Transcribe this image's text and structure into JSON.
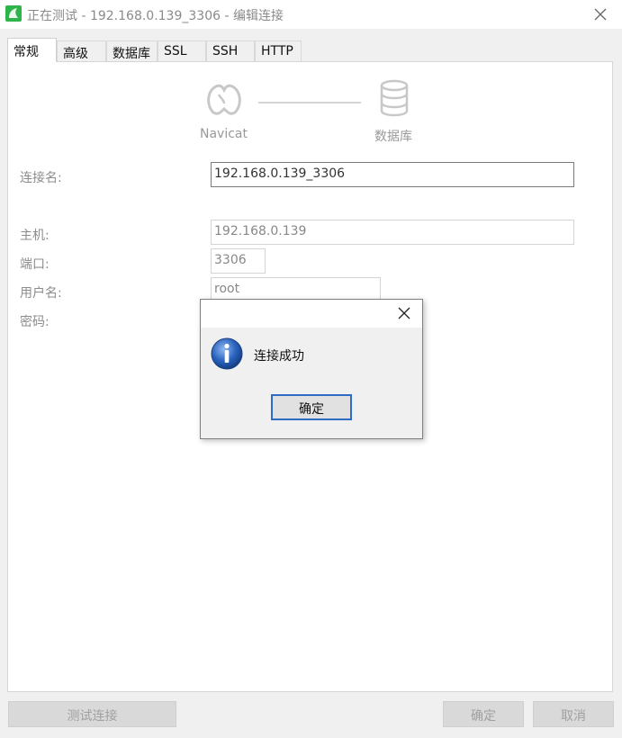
{
  "window": {
    "title": "正在测试 - 192.168.0.139_3306 - 编辑连接",
    "icons": {
      "app": "navicat-app-icon",
      "close": "close-icon"
    }
  },
  "tabs": [
    {
      "label": "常规",
      "active": true
    },
    {
      "label": "高级",
      "active": false
    },
    {
      "label": "数据库",
      "active": false
    },
    {
      "label": "SSL",
      "active": false
    },
    {
      "label": "SSH",
      "active": false
    },
    {
      "label": "HTTP",
      "active": false
    }
  ],
  "header": {
    "left_caption": "Navicat",
    "right_caption": "数据库",
    "icons": {
      "left": "navicat-seal-logo-icon",
      "right": "database-icon"
    }
  },
  "form": {
    "connection_name": {
      "label": "连接名:",
      "value": "192.168.0.139_3306"
    },
    "host": {
      "label": "主机:",
      "value": "192.168.0.139"
    },
    "port": {
      "label": "端口:",
      "value": "3306"
    },
    "username": {
      "label": "用户名:",
      "value": "root"
    },
    "password": {
      "label": "密码:"
    }
  },
  "footer": {
    "test_button": "测试连接",
    "ok_button": "确定",
    "cancel_button": "取消"
  },
  "dialog": {
    "message": "连接成功",
    "ok_button": "确定",
    "icons": {
      "info": "info-icon",
      "close": "close-icon"
    }
  },
  "colors": {
    "app_icon": "#2eb44a",
    "info_icon": "#1f5fb8",
    "focus_border": "#2d6bc4"
  }
}
